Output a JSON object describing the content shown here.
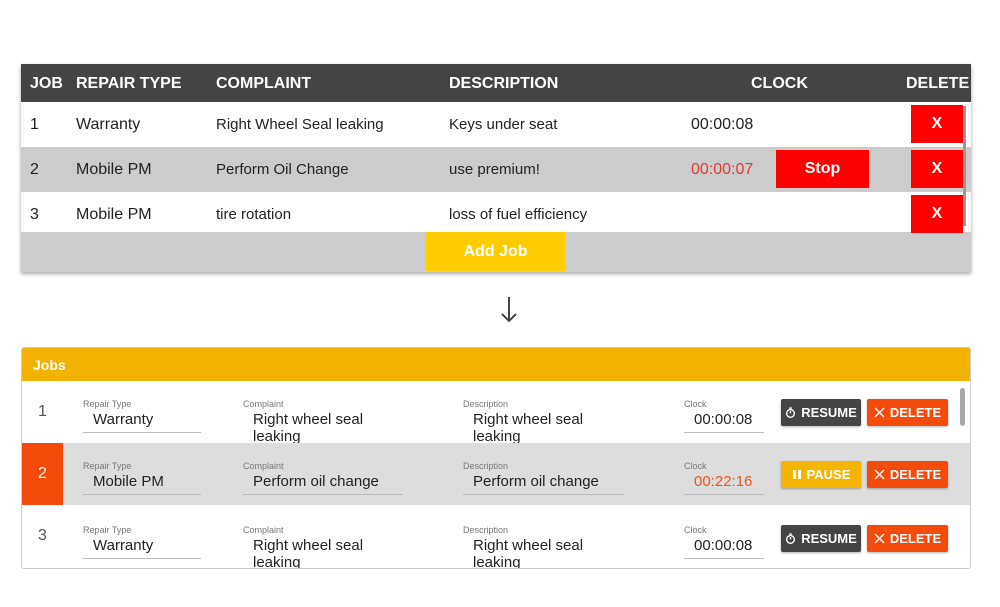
{
  "old_table": {
    "headers": [
      "JOB",
      "REPAIR TYPE",
      "COMPLAINT",
      "DESCRIPTION",
      "CLOCK",
      "DELETE"
    ],
    "rows": [
      {
        "job": "1",
        "repair_type": "Warranty",
        "complaint": "Right Wheel Seal leaking",
        "description": "Keys under seat",
        "clock": "00:00:08",
        "delete": "X"
      },
      {
        "job": "2",
        "repair_type": "Mobile PM",
        "complaint": "Perform Oil Change",
        "description": "use premium!",
        "clock": "00:00:07",
        "stop": "Stop",
        "delete": "X"
      },
      {
        "job": "3",
        "repair_type": "Mobile PM",
        "complaint": "tire rotation",
        "description": "loss of fuel efficiency",
        "clock": "",
        "delete": "X"
      }
    ],
    "add_job": "Add Job",
    "colors": {
      "header": "#444444",
      "danger": "#ff0000",
      "accent": "#ffcc00",
      "active_clock": "#e53935"
    }
  },
  "arrow_icon": "arrow-down-icon",
  "new_card": {
    "title": "Jobs",
    "labels": {
      "repair_type": "Repair Type",
      "complaint": "Complaint",
      "description": "Description",
      "clock": "Clock"
    },
    "rows": [
      {
        "job": "1",
        "repair_type": "Warranty",
        "complaint": "Right wheel seal leaking",
        "description": "Right wheel seal leaking",
        "clock": "00:00:08",
        "action": "RESUME",
        "action_icon": "timer-icon",
        "delete": "DELETE",
        "active": false
      },
      {
        "job": "2",
        "repair_type": "Mobile PM",
        "complaint": "Perform oil change",
        "description": "Perform oil change",
        "clock": "00:22:16",
        "action": "PAUSE",
        "action_icon": "pause-icon",
        "delete": "DELETE",
        "active": true
      },
      {
        "job": "3",
        "repair_type": "Warranty",
        "complaint": "Right wheel seal leaking",
        "description": "Right wheel seal leaking",
        "clock": "00:00:08",
        "action": "RESUME",
        "action_icon": "timer-icon",
        "delete": "DELETE",
        "active": false
      }
    ],
    "colors": {
      "header": "#f2b200",
      "delete": "#f44a0a",
      "resume": "#444444",
      "pause": "#f4b400",
      "active_row": "#dddddd",
      "active_clock": "#f4511e"
    }
  }
}
